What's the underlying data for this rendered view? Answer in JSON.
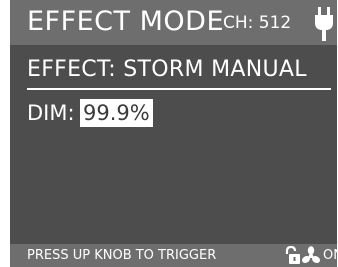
{
  "header": {
    "title": "EFFECT MODE",
    "channel": "CH: 512",
    "plug_icon": "power-plug-icon"
  },
  "effect": {
    "label": "EFFECT: STORM MANUAL"
  },
  "dim": {
    "label": "DIM:",
    "value": "99.9%"
  },
  "footer": {
    "hint": "PRESS UP KNOB TO TRIGGER",
    "lock_icon": "unlocked-padlock-icon",
    "fan_icon": "fan-icon",
    "status": "ON"
  },
  "colors": {
    "screen_background": "#4d4d4d",
    "bar_background": "#6e6e6e",
    "text": "#ffffff"
  }
}
